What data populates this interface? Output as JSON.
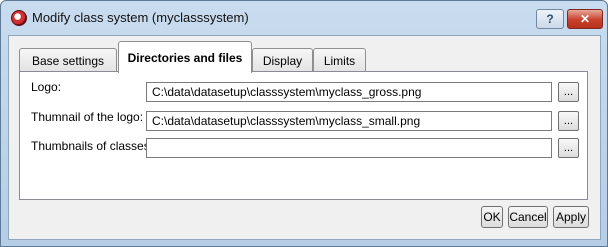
{
  "window": {
    "title": "Modify class system (myclasssystem)"
  },
  "titlebar": {
    "help_label": "?",
    "close_label": "✕"
  },
  "tabs": [
    {
      "label": "Base settings",
      "active": false
    },
    {
      "label": "Directories and files",
      "active": true
    },
    {
      "label": "Display",
      "active": false
    },
    {
      "label": "Limits",
      "active": false
    }
  ],
  "fields": [
    {
      "label": "Logo:",
      "value": "C:\\data\\datasetup\\classsystem\\myclass_gross.png",
      "browse_label": "..."
    },
    {
      "label": "Thumnail of the logo:",
      "value": "C:\\data\\datasetup\\classsystem\\myclass_small.png",
      "browse_label": "..."
    },
    {
      "label": "Thumbnails of classes:",
      "value": "",
      "browse_label": "..."
    }
  ],
  "buttons": {
    "ok": "OK",
    "cancel": "Cancel",
    "apply": "Apply"
  }
}
